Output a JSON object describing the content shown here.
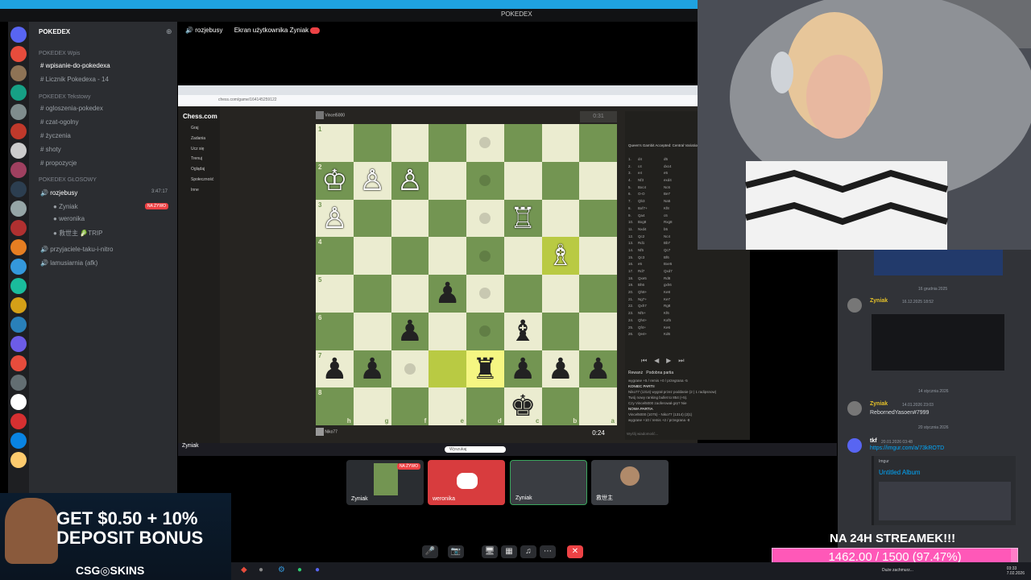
{
  "window": {
    "title": "POKEDEX"
  },
  "server": {
    "name": "POKEDEX"
  },
  "channels": [
    {
      "label": "POKEDEX Wpis",
      "kind": "category"
    },
    {
      "label": "wpisanie-do-pokedexa",
      "kind": "text",
      "active": true
    },
    {
      "label": "Licznik Pokedexa - 14",
      "kind": "text"
    },
    {
      "label": "POKEDEX Tekstowy",
      "kind": "category"
    },
    {
      "label": "ogloszenia-pokedex",
      "kind": "text"
    },
    {
      "label": "czat-ogolny",
      "kind": "text"
    },
    {
      "label": "życzenia",
      "kind": "text"
    },
    {
      "label": "shoty",
      "kind": "text"
    },
    {
      "label": "propozycje",
      "kind": "text"
    },
    {
      "label": "POKEDEX GŁOSOWY",
      "kind": "category"
    },
    {
      "label": "rozjebusy",
      "kind": "voice",
      "active": true,
      "time": "3:47:17"
    },
    {
      "label": "Zyniak",
      "kind": "member",
      "badge": "NA ŻYWO"
    },
    {
      "label": "weronika",
      "kind": "member"
    },
    {
      "label": "救世主 🥬TRIP",
      "kind": "member"
    },
    {
      "label": "przyjaciele-taku-i-nitro",
      "kind": "voice"
    },
    {
      "label": "lamusiarnia (afk)",
      "kind": "voice"
    }
  ],
  "voice_header": {
    "channel": "rozjebusy",
    "screen": "Ekran użytkownika Zyniak"
  },
  "browser": {
    "url": "chess.com/game/164145259122"
  },
  "chess_nav": [
    "Graj",
    "Zadania",
    "Ucz się",
    "Trenuj",
    "Oglądaj",
    "Społeczność",
    "Inne"
  ],
  "chess": {
    "top_player": "Vincel5000",
    "top_clock": "0:31",
    "bottom_player": "Niko77",
    "bottom_clock": "0:24",
    "opening": "Queen's Gambit Accepted: Central Variation",
    "files": [
      "h",
      "g",
      "f",
      "e",
      "d",
      "c",
      "b",
      "a"
    ],
    "ranks": [
      "1",
      "2",
      "3",
      "4",
      "5",
      "6",
      "7",
      "8"
    ],
    "pieces": [
      {
        "sq": "r2c1",
        "p": "♔",
        "c": "w"
      },
      {
        "sq": "r2c2",
        "p": "♙",
        "c": "w"
      },
      {
        "sq": "r2c3",
        "p": "♙",
        "c": "w"
      },
      {
        "sq": "r3c1",
        "p": "♙",
        "c": "w"
      },
      {
        "sq": "r3c6",
        "p": "♖",
        "c": "w"
      },
      {
        "sq": "r4c7",
        "p": "♗",
        "c": "w"
      },
      {
        "sq": "r5c4",
        "p": "♟",
        "c": "b"
      },
      {
        "sq": "r6c3",
        "p": "♟",
        "c": "b"
      },
      {
        "sq": "r6c6",
        "p": "♝",
        "c": "b"
      },
      {
        "sq": "r7c1",
        "p": "♟",
        "c": "b"
      },
      {
        "sq": "r7c2",
        "p": "♟",
        "c": "b"
      },
      {
        "sq": "r7c5",
        "p": "♜",
        "c": "b"
      },
      {
        "sq": "r7c6",
        "p": "♟",
        "c": "b"
      },
      {
        "sq": "r7c7",
        "p": "♟",
        "c": "b"
      },
      {
        "sq": "r7c8",
        "p": "♟",
        "c": "b"
      },
      {
        "sq": "r8c6",
        "p": "♚",
        "c": "b"
      }
    ],
    "dots": [
      "r1c5",
      "r2c5",
      "r3c5",
      "r4c5",
      "r5c5",
      "r6c5",
      "r7c3"
    ],
    "highlights": [
      "r7c4",
      "r7c5",
      "r4c7"
    ],
    "moves": [
      [
        "1.",
        "d4",
        "d5"
      ],
      [
        "2.",
        "c4",
        "dxc4"
      ],
      [
        "3.",
        "e4",
        "e5"
      ],
      [
        "4.",
        "Nf3",
        "exd4"
      ],
      [
        "5.",
        "Bxc4",
        "Nc6"
      ],
      [
        "6.",
        "O-O",
        "Be7"
      ],
      [
        "7.",
        "Qb3",
        "Na5"
      ],
      [
        "8.",
        "Bxf7+",
        "Kf8"
      ],
      [
        "9.",
        "Qa4",
        "c6"
      ],
      [
        "10.",
        "Bxg8",
        "Rxg8"
      ],
      [
        "11.",
        "Nxd4",
        "b5"
      ],
      [
        "12.",
        "Qc2",
        "Nc4"
      ],
      [
        "13.",
        "Rd1",
        "Bb7"
      ],
      [
        "14.",
        "Nf5",
        "Qc7"
      ],
      [
        "15.",
        "Qc3",
        "Bf6"
      ],
      [
        "16.",
        "e5",
        "Bxe5"
      ],
      [
        "17.",
        "Rd7",
        "Qxd7"
      ],
      [
        "18.",
        "Qxe5",
        "Rd8"
      ],
      [
        "19.",
        "Bh6",
        "gxh6"
      ],
      [
        "20.",
        "Qh8+",
        "Ke8"
      ],
      [
        "21.",
        "Ng7+",
        "Ke7"
      ],
      [
        "22.",
        "Qxh7",
        "Rg8"
      ],
      [
        "23.",
        "Nf5+",
        "Kf6"
      ],
      [
        "24.",
        "Qh4+",
        "Kxf5"
      ],
      [
        "25.",
        "Qf4+",
        "Ke6"
      ],
      [
        "26.",
        "Qe4+",
        "Kd6"
      ]
    ],
    "result_lines": [
      "wygrane +5 / remis +0 / przegrana -5",
      "KONIEC PARTII",
      "Niko77 (1314) wygrał przez poddanie (2 | 1 radipsnow)",
      "Twój nowy ranking bullet to 854 (+5).",
      "Czy Vincel5000 zaoferował grę? Nie",
      "NOWA PARTIA",
      "Vincel5000 (1075) - Niko77 (1314) (2|1)",
      "wygrane +10 / remis +2 / przegrana -8"
    ],
    "chat_placeholder": "Wyślij wiadomość...",
    "buttons": [
      "Rewanż",
      "Podobna partia"
    ]
  },
  "taskbar": {
    "search": "Wyszukaj"
  },
  "chat": {
    "dates": [
      "16 grudnia 2025",
      "14 stycznia 2026",
      "20 stycznia 2026"
    ],
    "messages": [
      {
        "user": "Zyniak",
        "time": "16.12.2025 18:52",
        "text": ""
      },
      {
        "user": "Zyniak",
        "time": "14.01.2026 23:03",
        "text": "RebornedYasoen#7999"
      },
      {
        "user": "tkf",
        "time": "20.01.2026 03:48",
        "text": "https://imgur.com/a/73kROTD"
      }
    ],
    "embed_source": "Imgur",
    "embed_title": "Untitled Album"
  },
  "call_tiles": [
    {
      "name": "Zyniak",
      "badge": "NA ŻYWO"
    },
    {
      "name": "weronika"
    },
    {
      "name": "Zyniak"
    },
    {
      "name": "救世主"
    }
  ],
  "ad": {
    "line1": "GET $0.50 + 10%",
    "line2": "DEPOSIT BONUS",
    "brand": "CSG◎SKINS"
  },
  "goal": {
    "title": "NA 24H STREAMEK!!!",
    "text": "1462.00 / 1500 (97.47%)",
    "fraction": 0.9747
  },
  "system": {
    "weather": "Duże zachmurz...",
    "time": "03:33",
    "date": "7.02.2026"
  },
  "colors": {
    "accent": "#1fa2e0",
    "live": "#ed4245",
    "goal": "#ff58b8",
    "board_light": "#ebecd0",
    "board_dark": "#739552"
  }
}
